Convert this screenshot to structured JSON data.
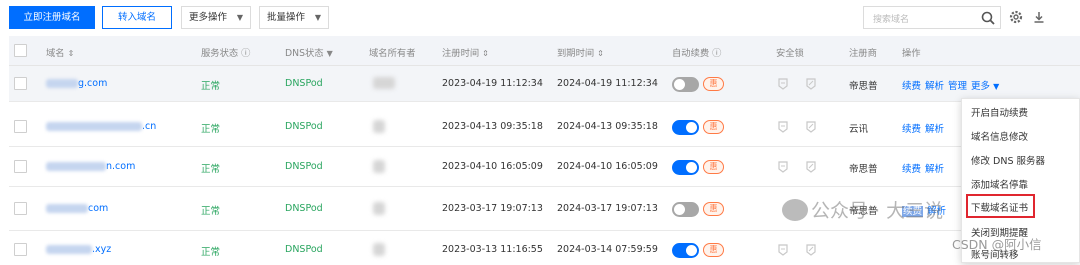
{
  "toolbar": {
    "register_label": "立即注册域名",
    "transfer_label": "转入域名",
    "more_ops_label": "更多操作",
    "batch_ops_label": "批量操作",
    "search_placeholder": "搜索域名"
  },
  "columns": {
    "domain": "域名",
    "service_status": "服务状态",
    "dns_status": "DNS状态",
    "owner": "域名所有者",
    "reg_time": "注册时间",
    "exp_time": "到期时间",
    "auto_renew": "自动续费",
    "security_lock": "安全锁",
    "registrar": "注册商",
    "actions": "操作"
  },
  "rows": [
    {
      "domain_suffix": "g.com",
      "status": "正常",
      "dns": "DNSPod",
      "reg": "2023-04-19 11:12:34",
      "exp": "2024-04-19 11:12:34",
      "auto_renew": false,
      "badge": "惠",
      "registrar": "帝思普"
    },
    {
      "domain_suffix": ".cn",
      "status": "正常",
      "dns": "DNSPod",
      "reg": "2023-04-13 09:35:18",
      "exp": "2024-04-13 09:35:18",
      "auto_renew": true,
      "badge": "惠",
      "registrar": "云讯"
    },
    {
      "domain_suffix": "n.com",
      "status": "正常",
      "dns": "DNSPod",
      "reg": "2023-04-10 16:05:09",
      "exp": "2024-04-10 16:05:09",
      "auto_renew": true,
      "badge": "惠",
      "registrar": "帝思普"
    },
    {
      "domain_suffix": "com",
      "status": "正常",
      "dns": "DNSPod",
      "reg": "2023-03-17 19:07:13",
      "exp": "2024-03-17 19:07:13",
      "auto_renew": false,
      "badge": "惠",
      "registrar": "帝思普"
    },
    {
      "domain_suffix": ".xyz",
      "status": "正常",
      "dns": "DNSPod",
      "reg": "2023-03-13 11:16:55",
      "exp": "2024-03-14 07:59:59",
      "auto_renew": true,
      "badge": "惠",
      "registrar": ""
    }
  ],
  "row_actions": {
    "renew": "续费",
    "resolve": "解析",
    "manage": "管理",
    "more": "更多"
  },
  "more_menu": [
    "开启自动续费",
    "域名信息修改",
    "修改 DNS 服务器",
    "添加域名停靠",
    "下载域名证书",
    "关闭到期提醒",
    "账号间转移"
  ],
  "watermark": {
    "wechat": "公众号 · 大三说",
    "csdn": "CSDN @阿小信"
  },
  "colors": {
    "primary": "#006eff",
    "success": "#29a55f",
    "badge": "#ff7a45",
    "highlight": "#e0262f"
  }
}
